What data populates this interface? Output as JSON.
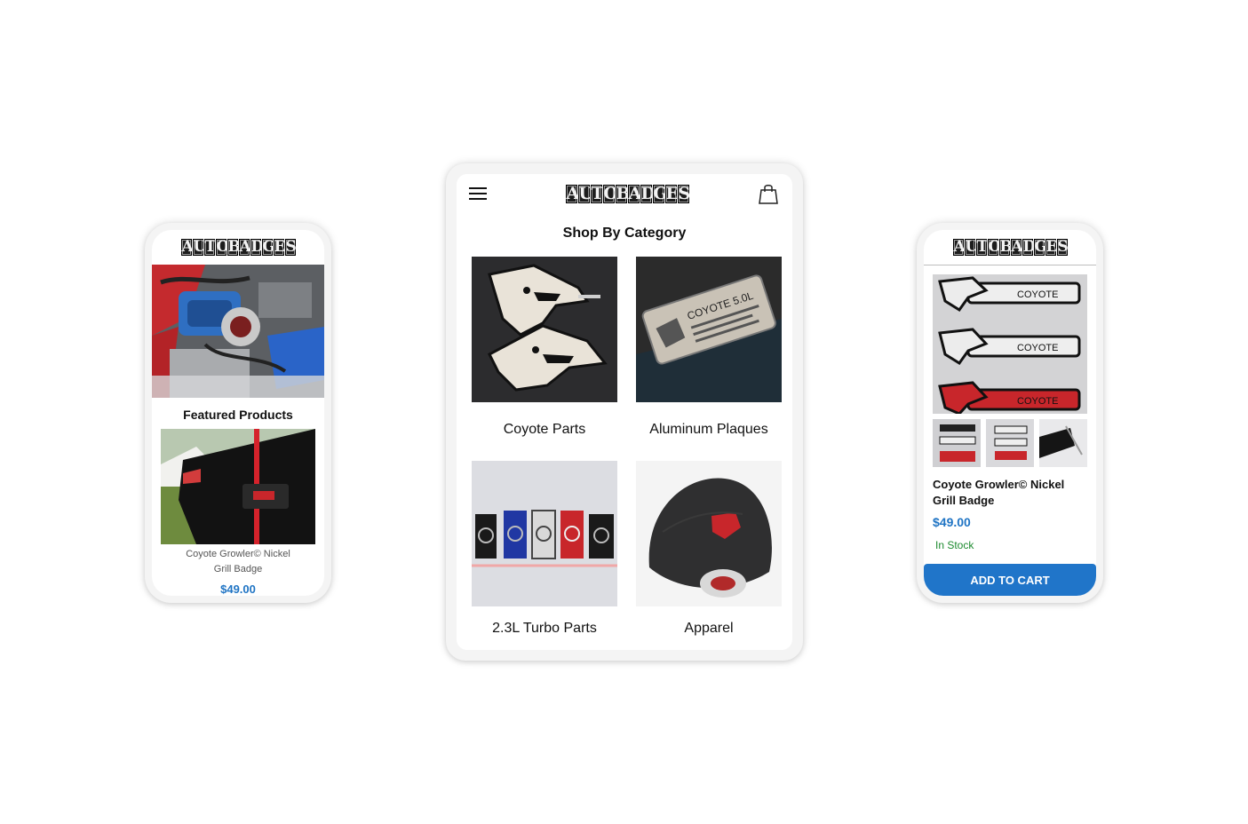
{
  "brand": {
    "logo_text": "AUTOBADGES"
  },
  "left_phone": {
    "section_title": "Featured Products",
    "product_name_line1": "Coyote Growler© Nickel",
    "product_name_line2": "Grill Badge",
    "price": "$49.00"
  },
  "center_tablet": {
    "heading": "Shop By Category",
    "categories": [
      {
        "label": "Coyote Parts"
      },
      {
        "label": "Aluminum Plaques"
      },
      {
        "label": "2.3L Turbo Parts"
      },
      {
        "label": "Apparel"
      }
    ],
    "plaque_text": "COYOTE 5.0L"
  },
  "right_phone": {
    "product_name_line1": "Coyote Growler© Nickel",
    "product_name_line2": "Grill Badge",
    "price": "$49.00",
    "stock_status": "In Stock",
    "add_to_cart_label": "ADD TO CART",
    "badge_text": "COYOTE"
  },
  "colors": {
    "price_blue": "#1f74c4",
    "stock_green": "#1c8a2e",
    "cart_button": "#2075c9",
    "badge_red": "#c8262b"
  },
  "icons": {
    "menu": "hamburger-menu-icon",
    "cart": "shopping-bag-icon"
  }
}
